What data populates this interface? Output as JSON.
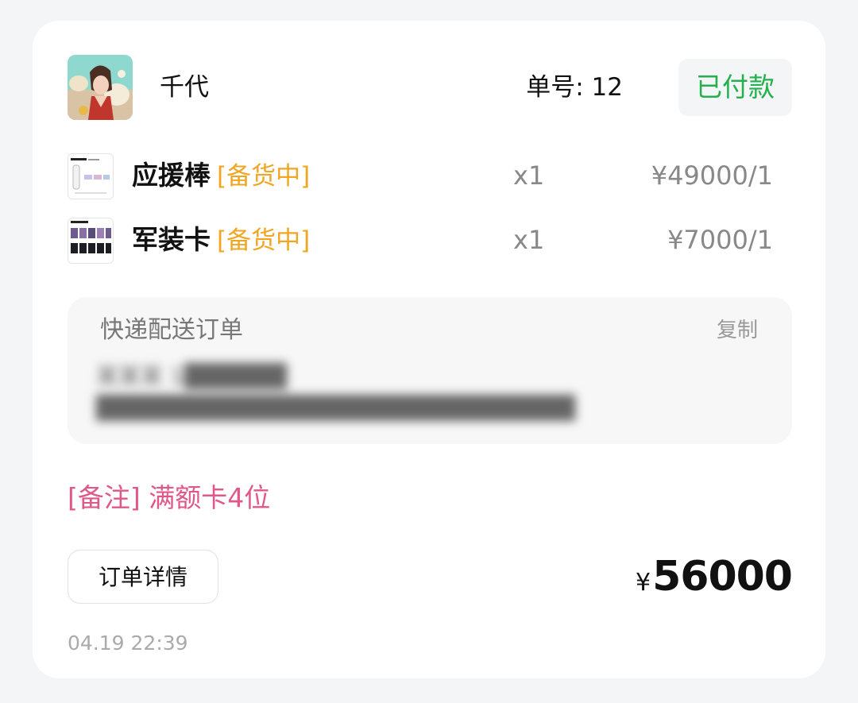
{
  "shop": {
    "name": "千代",
    "avatar_icon": "avatar-illustration"
  },
  "order": {
    "number_text": "单号: 12",
    "status": "已付款",
    "status_color": "#22b14c"
  },
  "items": [
    {
      "name": "应援棒",
      "stock_status": "[备货中]",
      "quantity": "x1",
      "price": "¥49000/1",
      "thumb_icon": "light-stick-thumbnail"
    },
    {
      "name": "军装卡",
      "stock_status": "[备货中]",
      "quantity": "x1",
      "price": "¥7000/1",
      "thumb_icon": "photocard-thumbnail"
    }
  ],
  "shipping": {
    "title": "快递配送订单",
    "copy_label": "复制",
    "redacted_line1": "某某某 1██████",
    "redacted_line2": "████████████████████████████"
  },
  "remark": "[备注] 满额卡4位",
  "footer": {
    "detail_button_label": "订单详情",
    "currency_symbol": "¥",
    "total_amount": "56000",
    "timestamp": "04.19 22:39"
  },
  "colors": {
    "accent_stock": "#f0a623",
    "accent_remark": "#e0578a"
  }
}
